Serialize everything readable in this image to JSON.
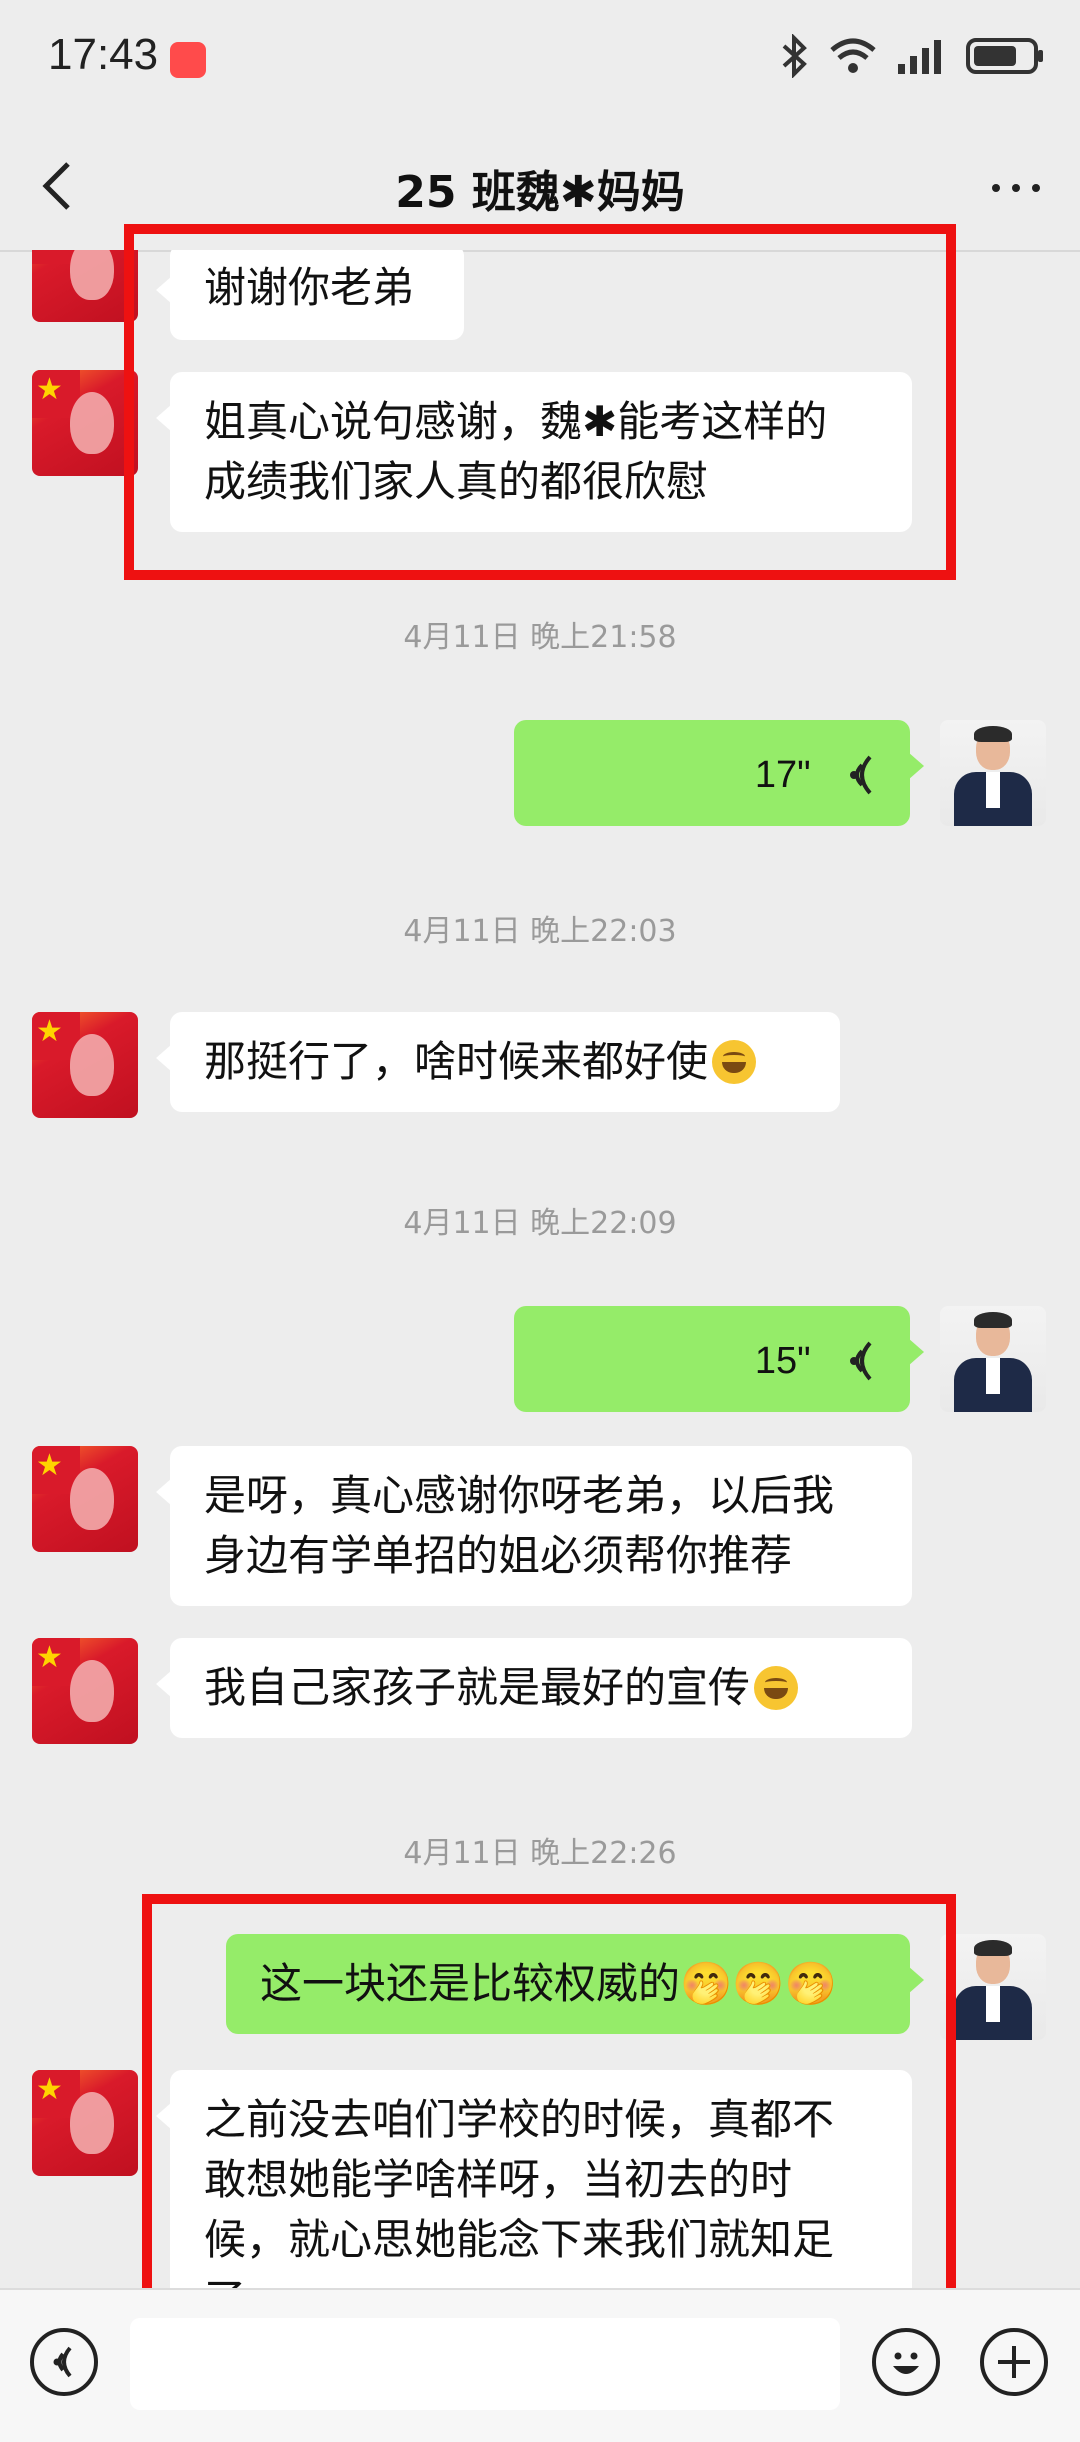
{
  "status": {
    "time": "17:43"
  },
  "header": {
    "title": "25 班魏✱妈妈"
  },
  "messages": {
    "m1": "谢谢你老弟",
    "m2_line1": "姐真心说句感谢，魏✱能考这样的",
    "m2_line2": "成绩我们家人真的都很欣慰",
    "ts1": "4月11日 晚上21:58",
    "v1": "17\"",
    "ts2": "4月11日 晚上22:03",
    "m3": "那挺行了，啥时候来都好使",
    "ts3": "4月11日 晚上22:09",
    "v2": "15\"",
    "m4_line1": "是呀，真心感谢你呀老弟，以后我",
    "m4_line2": "身边有学单招的姐必须帮你推荐",
    "m5": "我自己家孩子就是最好的宣传",
    "ts4": "4月11日 晚上22:26",
    "m6": "这一块还是比较权威的🤭🤭🤭",
    "m7_line1": "之前没去咱们学校的时候，真都不",
    "m7_line2": "敢想她能学啥样呀，当初去的时",
    "m7_line3": "候，就心思她能念下来我们就知足",
    "m7_line4": "了"
  },
  "icons": [
    "back-arrow-icon",
    "more-icon",
    "voice-wave-icon",
    "voice-input-icon",
    "emoji-icon",
    "plus-icon"
  ],
  "colors": {
    "sent_bubble": "#95ec69",
    "received_bubble": "#ffffff",
    "highlight": "#ee1111"
  }
}
